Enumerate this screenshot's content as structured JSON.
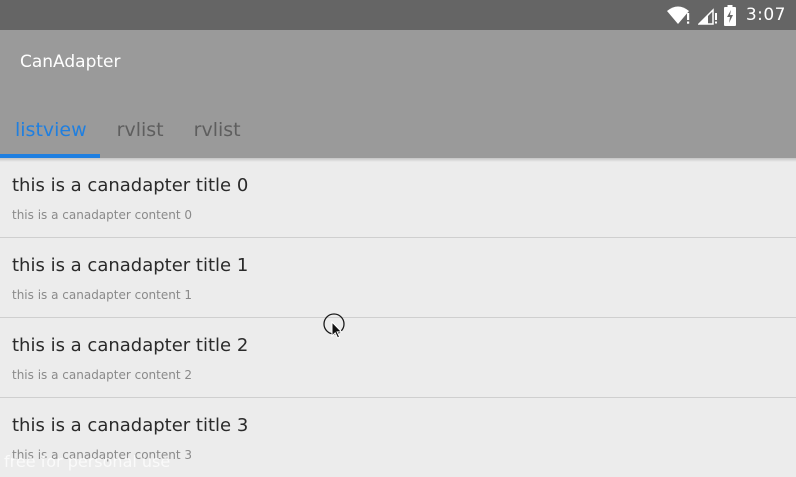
{
  "status_bar": {
    "time": "3:07",
    "icons": [
      "wifi-icon",
      "signal-icon",
      "battery-charging-icon"
    ]
  },
  "app_bar": {
    "title": "CanAdapter"
  },
  "tabs": [
    {
      "label": "listview",
      "active": true
    },
    {
      "label": "rvlist",
      "active": false
    },
    {
      "label": "rvlist",
      "active": false
    }
  ],
  "list": {
    "items": [
      {
        "title": "this is a canadapter title 0",
        "content": "this is a canadapter content 0"
      },
      {
        "title": "this is a canadapter title 1",
        "content": "this is a canadapter content 1"
      },
      {
        "title": "this is a canadapter title 2",
        "content": "this is a canadapter content 2"
      },
      {
        "title": "this is a canadapter title 3",
        "content": "this is a canadapter content 3"
      }
    ]
  },
  "watermark": {
    "text": "free for personal use"
  },
  "colors": {
    "status_bar": "#656565",
    "app_bar": "#9a9a9a",
    "accent": "#1f7fe0",
    "background": "#ececec",
    "divider": "#cfcfcf"
  }
}
